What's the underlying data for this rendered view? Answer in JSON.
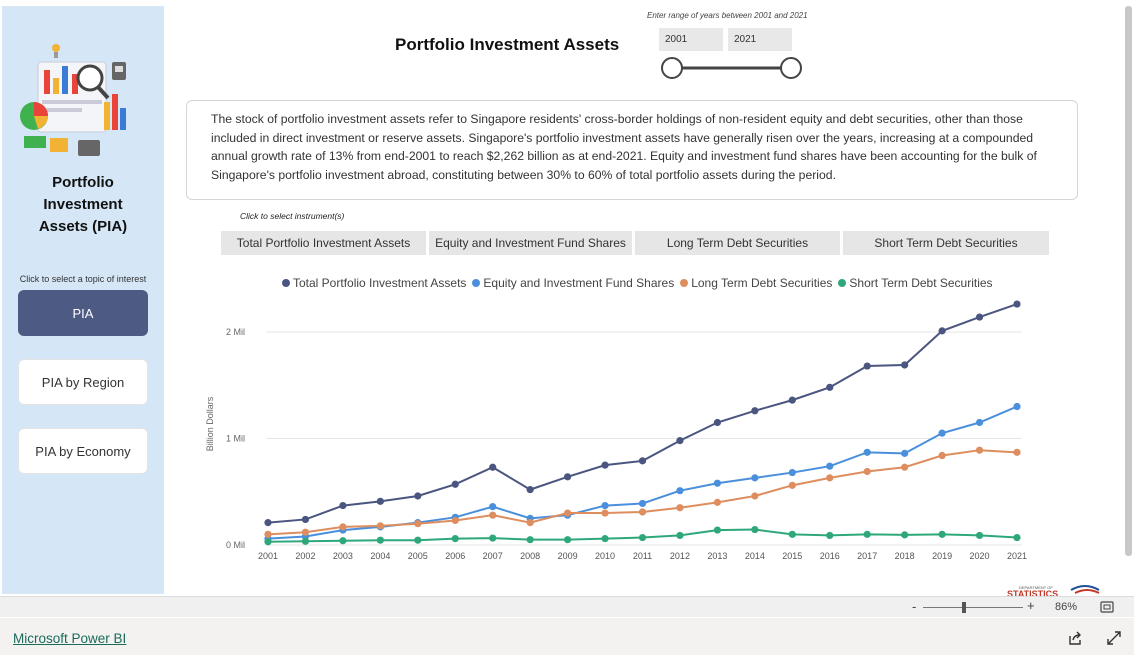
{
  "sidebar": {
    "title": "Portfolio\nInvestment\nAssets (PIA)",
    "hint": "Click to select a topic of interest",
    "topics": [
      {
        "label": "PIA",
        "active": true
      },
      {
        "label": "PIA by Region",
        "active": false
      },
      {
        "label": "PIA by Economy",
        "active": false
      }
    ]
  },
  "header": {
    "title": "Portfolio Investment Assets",
    "range_hint": "Enter range of years between 2001 and 2021",
    "range_start": "2001",
    "range_end": "2021"
  },
  "description": "The stock of portfolio investment assets refer to Singapore residents' cross-border holdings of non-resident equity and debt securities, other than those included in direct investment or reserve assets. Singapore's portfolio investment assets have generally risen over the years, increasing at a compounded annual growth rate of 13% from end-2001 to reach $2,262 billion as at end-2021. Equity and investment fund shares have been accounting for the bulk of Singapore's portfolio investment abroad, constituting between 30% to 60% of total portfolio assets during the period.",
  "instruments": {
    "hint": "Click to select instrument(s)",
    "buttons": [
      "Total Portfolio Investment Assets",
      "Equity and Investment Fund Shares",
      "Long Term Debt Securities",
      "Short Term Debt Securities"
    ]
  },
  "colors": {
    "sidebar_bg": "#d5e7f7",
    "active_topic": "#4d5b84",
    "series": [
      "#4a5580",
      "#4a8fdc",
      "#de8e5e",
      "#2ea87a"
    ]
  },
  "chart_data": {
    "type": "line",
    "ylabel": "Billion Dollars",
    "ylim": [
      0,
      2300
    ],
    "y_ticks": [
      0,
      1000,
      2000
    ],
    "y_tick_labels": [
      "0 Mil",
      "1 Mil",
      "2 Mil"
    ],
    "grid": true,
    "legend_position": "top",
    "x": [
      "2001",
      "2002",
      "2003",
      "2004",
      "2005",
      "2006",
      "2007",
      "2008",
      "2009",
      "2010",
      "2011",
      "2012",
      "2013",
      "2014",
      "2015",
      "2016",
      "2017",
      "2018",
      "2019",
      "2020",
      "2021"
    ],
    "series": [
      {
        "name": "Total Portfolio Investment Assets",
        "color": "#4a5580",
        "values": [
          210,
          240,
          370,
          410,
          460,
          570,
          730,
          520,
          640,
          750,
          790,
          980,
          1150,
          1260,
          1360,
          1480,
          1680,
          1690,
          2010,
          2140,
          2262
        ]
      },
      {
        "name": "Equity and Investment Fund Shares",
        "color": "#4a8fdc",
        "values": [
          60,
          80,
          140,
          170,
          210,
          260,
          360,
          250,
          280,
          370,
          390,
          510,
          580,
          630,
          680,
          740,
          870,
          860,
          1050,
          1150,
          1300
        ]
      },
      {
        "name": "Long Term Debt Securities",
        "color": "#de8e5e",
        "values": [
          100,
          120,
          170,
          180,
          200,
          230,
          280,
          210,
          300,
          300,
          310,
          350,
          400,
          460,
          560,
          630,
          690,
          730,
          840,
          890,
          870
        ]
      },
      {
        "name": "Short Term Debt Securities",
        "color": "#2ea87a",
        "values": [
          30,
          35,
          40,
          45,
          45,
          60,
          65,
          50,
          50,
          60,
          70,
          90,
          140,
          145,
          100,
          90,
          100,
          95,
          100,
          90,
          70
        ]
      }
    ]
  },
  "statusbar": {
    "zoom_minus": "-",
    "zoom_plus": "+",
    "zoom_level": "86%"
  },
  "footer": {
    "link": "Microsoft Power BI"
  }
}
